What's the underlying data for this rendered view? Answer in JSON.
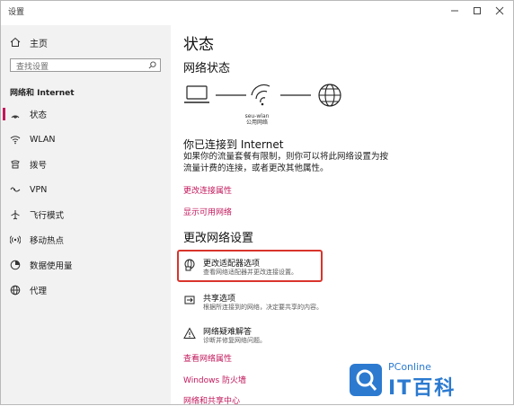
{
  "window": {
    "title": "设置"
  },
  "sidebar": {
    "home": "主页",
    "search_placeholder": "查找设置",
    "section": "网络和 Internet",
    "items": [
      {
        "label": "状态",
        "icon": "status-icon",
        "active": true
      },
      {
        "label": "WLAN",
        "icon": "wifi-icon"
      },
      {
        "label": "拨号",
        "icon": "dialup-icon"
      },
      {
        "label": "VPN",
        "icon": "vpn-icon"
      },
      {
        "label": "飞行模式",
        "icon": "airplane-icon"
      },
      {
        "label": "移动热点",
        "icon": "hotspot-icon"
      },
      {
        "label": "数据使用量",
        "icon": "data-usage-icon"
      },
      {
        "label": "代理",
        "icon": "proxy-icon"
      }
    ]
  },
  "main": {
    "title": "状态",
    "network_status_heading": "网络状态",
    "network_name": "seu-wlan",
    "network_type": "公用网络",
    "connected_heading": "你已连接到 Internet",
    "connected_desc": "如果你的流量套餐有限制，则你可以将此网络设置为按流量计费的连接，或者更改其他属性。",
    "link_change_connection": "更改连接属性",
    "link_show_networks": "显示可用网络",
    "change_settings_heading": "更改网络设置",
    "options": [
      {
        "title": "更改适配器选项",
        "desc": "查看网络适配器并更改连接设置。",
        "icon": "adapter-icon"
      },
      {
        "title": "共享选项",
        "desc": "根据所连接到的网络，决定要共享的内容。",
        "icon": "sharing-icon"
      },
      {
        "title": "网络疑难解答",
        "desc": "诊断并修复网络问题。",
        "icon": "warning-icon"
      }
    ],
    "link_view_properties": "查看网络属性",
    "link_firewall": "Windows 防火墙",
    "link_sharing_center": "网络和共享中心"
  },
  "watermark": {
    "brand": "PConline",
    "text": "IT百科"
  },
  "colors": {
    "accent": "#c2185b",
    "highlight": "#d9342b",
    "sidebar_bg": "#f2f2f2"
  }
}
